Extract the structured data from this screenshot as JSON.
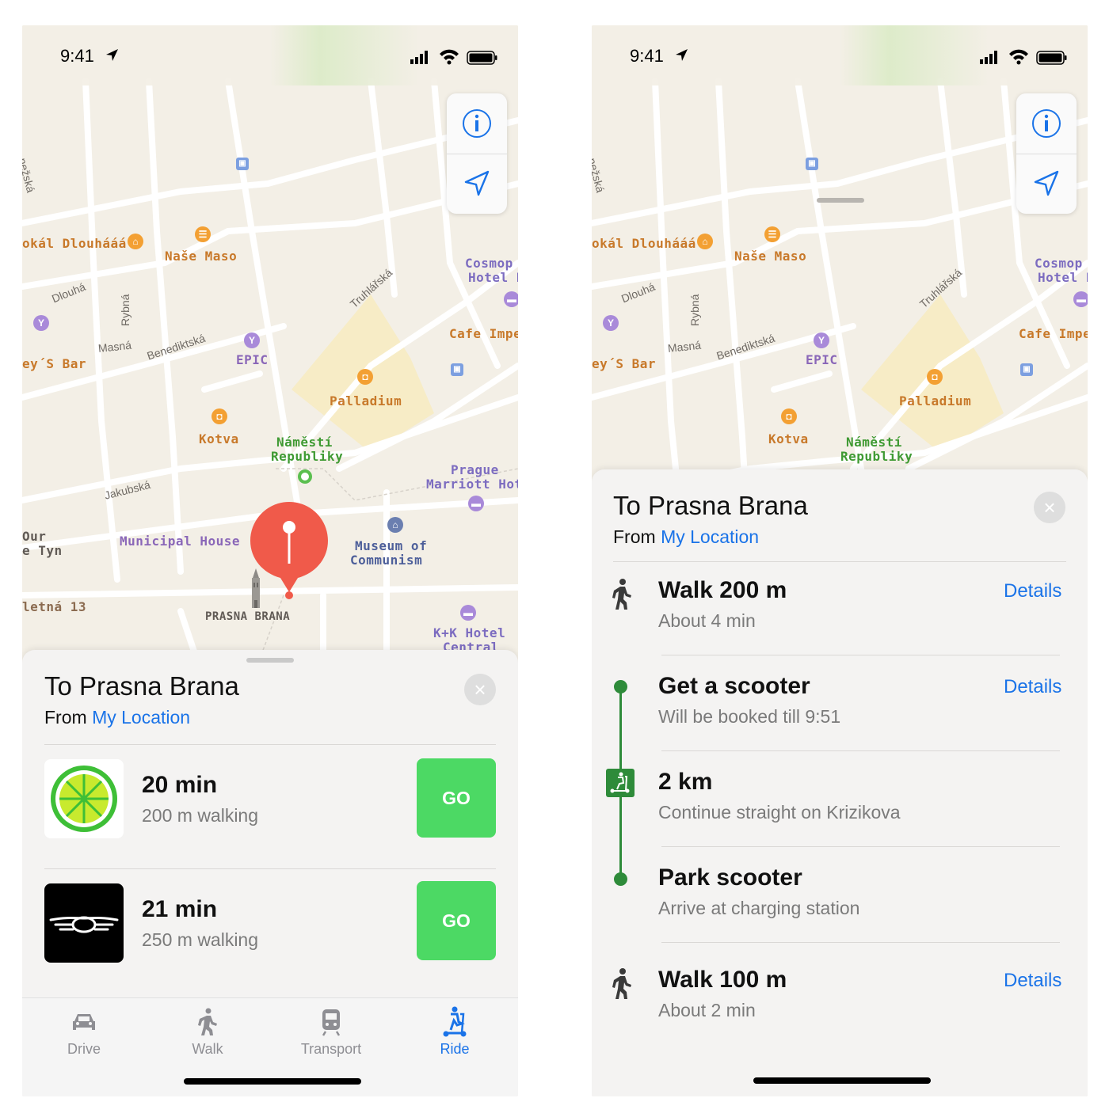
{
  "status_bar": {
    "time": "9:41"
  },
  "map": {
    "labels": {
      "lokal": "okál Dlouhááá",
      "nase_maso": "Naše Maso",
      "cosmo": "Cosmop",
      "cosmo2": "Hotel P",
      "cafe": "Cafe Impe",
      "bar": "ey´S Bar",
      "epic": "EPIC",
      "palladium": "Palladium",
      "kotva": "Kotva",
      "namesti1": "Náměstí",
      "namesti2": "Republiky",
      "prague1": "Prague",
      "prague2": "Marriott Hote",
      "municipal": "Municipal House",
      "museum1": "Museum of",
      "museum2": "Communism",
      "prasna": "PRASNA BRANA",
      "ktyn1": "Our",
      "ktyn2": "e Tyn",
      "letna": "letná 13",
      "kk1": "K+K Hotel",
      "kk2": "Central"
    },
    "streets": {
      "dlouha": "Dlouhá",
      "rybna": "Rybná",
      "masna": "Masná",
      "benediktska": "Benediktská",
      "truhlarska": "Truhlářská",
      "jakubska": "Jakubská",
      "anezska": "nežská"
    }
  },
  "left": {
    "sheet": {
      "title": "To Prasna Brana",
      "from_prefix": "From",
      "from_link": "My Location"
    },
    "options": [
      {
        "provider": "lime",
        "time": "20 min",
        "walking": "200 m walking",
        "go": "GO"
      },
      {
        "provider": "bird",
        "time": "21 min",
        "walking": "250 m walking",
        "go": "GO"
      }
    ],
    "tabs": [
      {
        "label": "Drive",
        "icon": "car-icon"
      },
      {
        "label": "Walk",
        "icon": "walk-icon"
      },
      {
        "label": "Transport",
        "icon": "train-icon"
      },
      {
        "label": "Ride",
        "icon": "scooter-icon",
        "active": true
      }
    ]
  },
  "right": {
    "sheet": {
      "title": "To Prasna Brana",
      "from_prefix": "From",
      "from_link": "My Location"
    },
    "steps": [
      {
        "title": "Walk 200 m",
        "sub": "About 4 min",
        "details": "Details",
        "icon": "walk-icon"
      },
      {
        "title": "Get a scooter",
        "sub": "Will be booked till 9:51",
        "details": "Details",
        "icon": "dot-icon"
      },
      {
        "title": "2 km",
        "sub": "Continue straight on Krizikova",
        "icon": "scooter-icon"
      },
      {
        "title": "Park scooter",
        "sub": "Arrive at charging station",
        "icon": "dot-icon"
      },
      {
        "title": "Walk 100 m",
        "sub": "About 2 min",
        "details": "Details",
        "icon": "walk-icon"
      }
    ]
  },
  "colors": {
    "accent": "#1a73e8",
    "go_green": "#4cd964",
    "route_green": "#2e8b3a",
    "pin_red": "#f05a4a",
    "map_bg": "#f3efe6"
  }
}
